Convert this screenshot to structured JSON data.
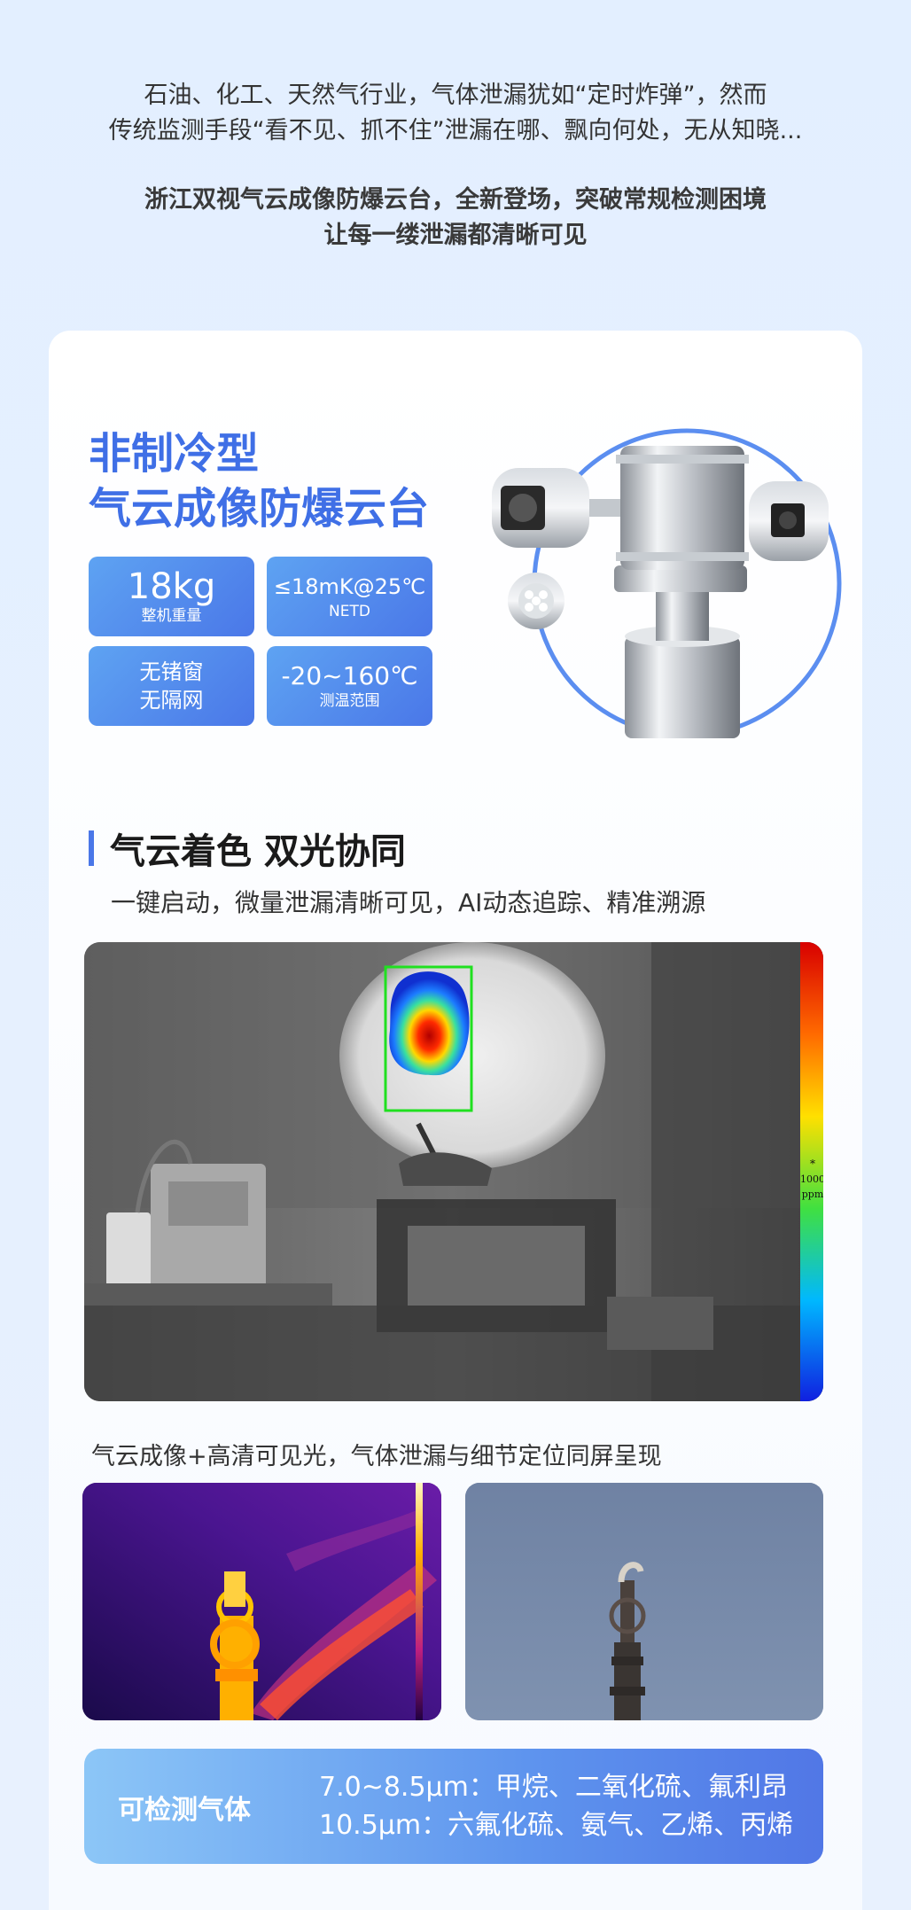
{
  "intro": {
    "line1": "石油、化工、天然气行业，气体泄漏犹如“定时炸弹”，然而",
    "line2": "传统监测手段“看不见、抓不住”泄漏在哪、飘向何处，无从知晓...",
    "bold1": "浙江双视气云成像防爆云台，全新登场，突破常规检测困境",
    "bold2": "让每一缕泄漏都清晰可见"
  },
  "product": {
    "title_line1": "非制冷型",
    "title_line2": "气云成像防爆云台",
    "specs": [
      {
        "value": "18kg",
        "label": "整机重量"
      },
      {
        "value": "≤18mK@25℃",
        "label": "NETD"
      },
      {
        "value": "无锗窗",
        "label": "无隔网"
      },
      {
        "value": "-20~160℃",
        "label": "测温范围"
      }
    ]
  },
  "section": {
    "title": "气云着色 双光协同",
    "subtitle": "一键启动，微量泄漏清晰可见，AI动态追踪、精准溯源"
  },
  "thermal": {
    "scale_mark": "*",
    "scale_value": "1000",
    "scale_unit": "ppm"
  },
  "caption": "气云成像+高清可见光，气体泄漏与细节定位同屏呈现",
  "gas": {
    "label": "可检测气体",
    "line1": "7.0~8.5μm：甲烷、二氧化硫、氟利昂",
    "line2": "10.5μm：六氟化硫、氨气、乙烯、丙烯"
  },
  "colors": {
    "accent": "#4a77e8",
    "title": "#3f6fe6",
    "background": "#e3efff"
  }
}
